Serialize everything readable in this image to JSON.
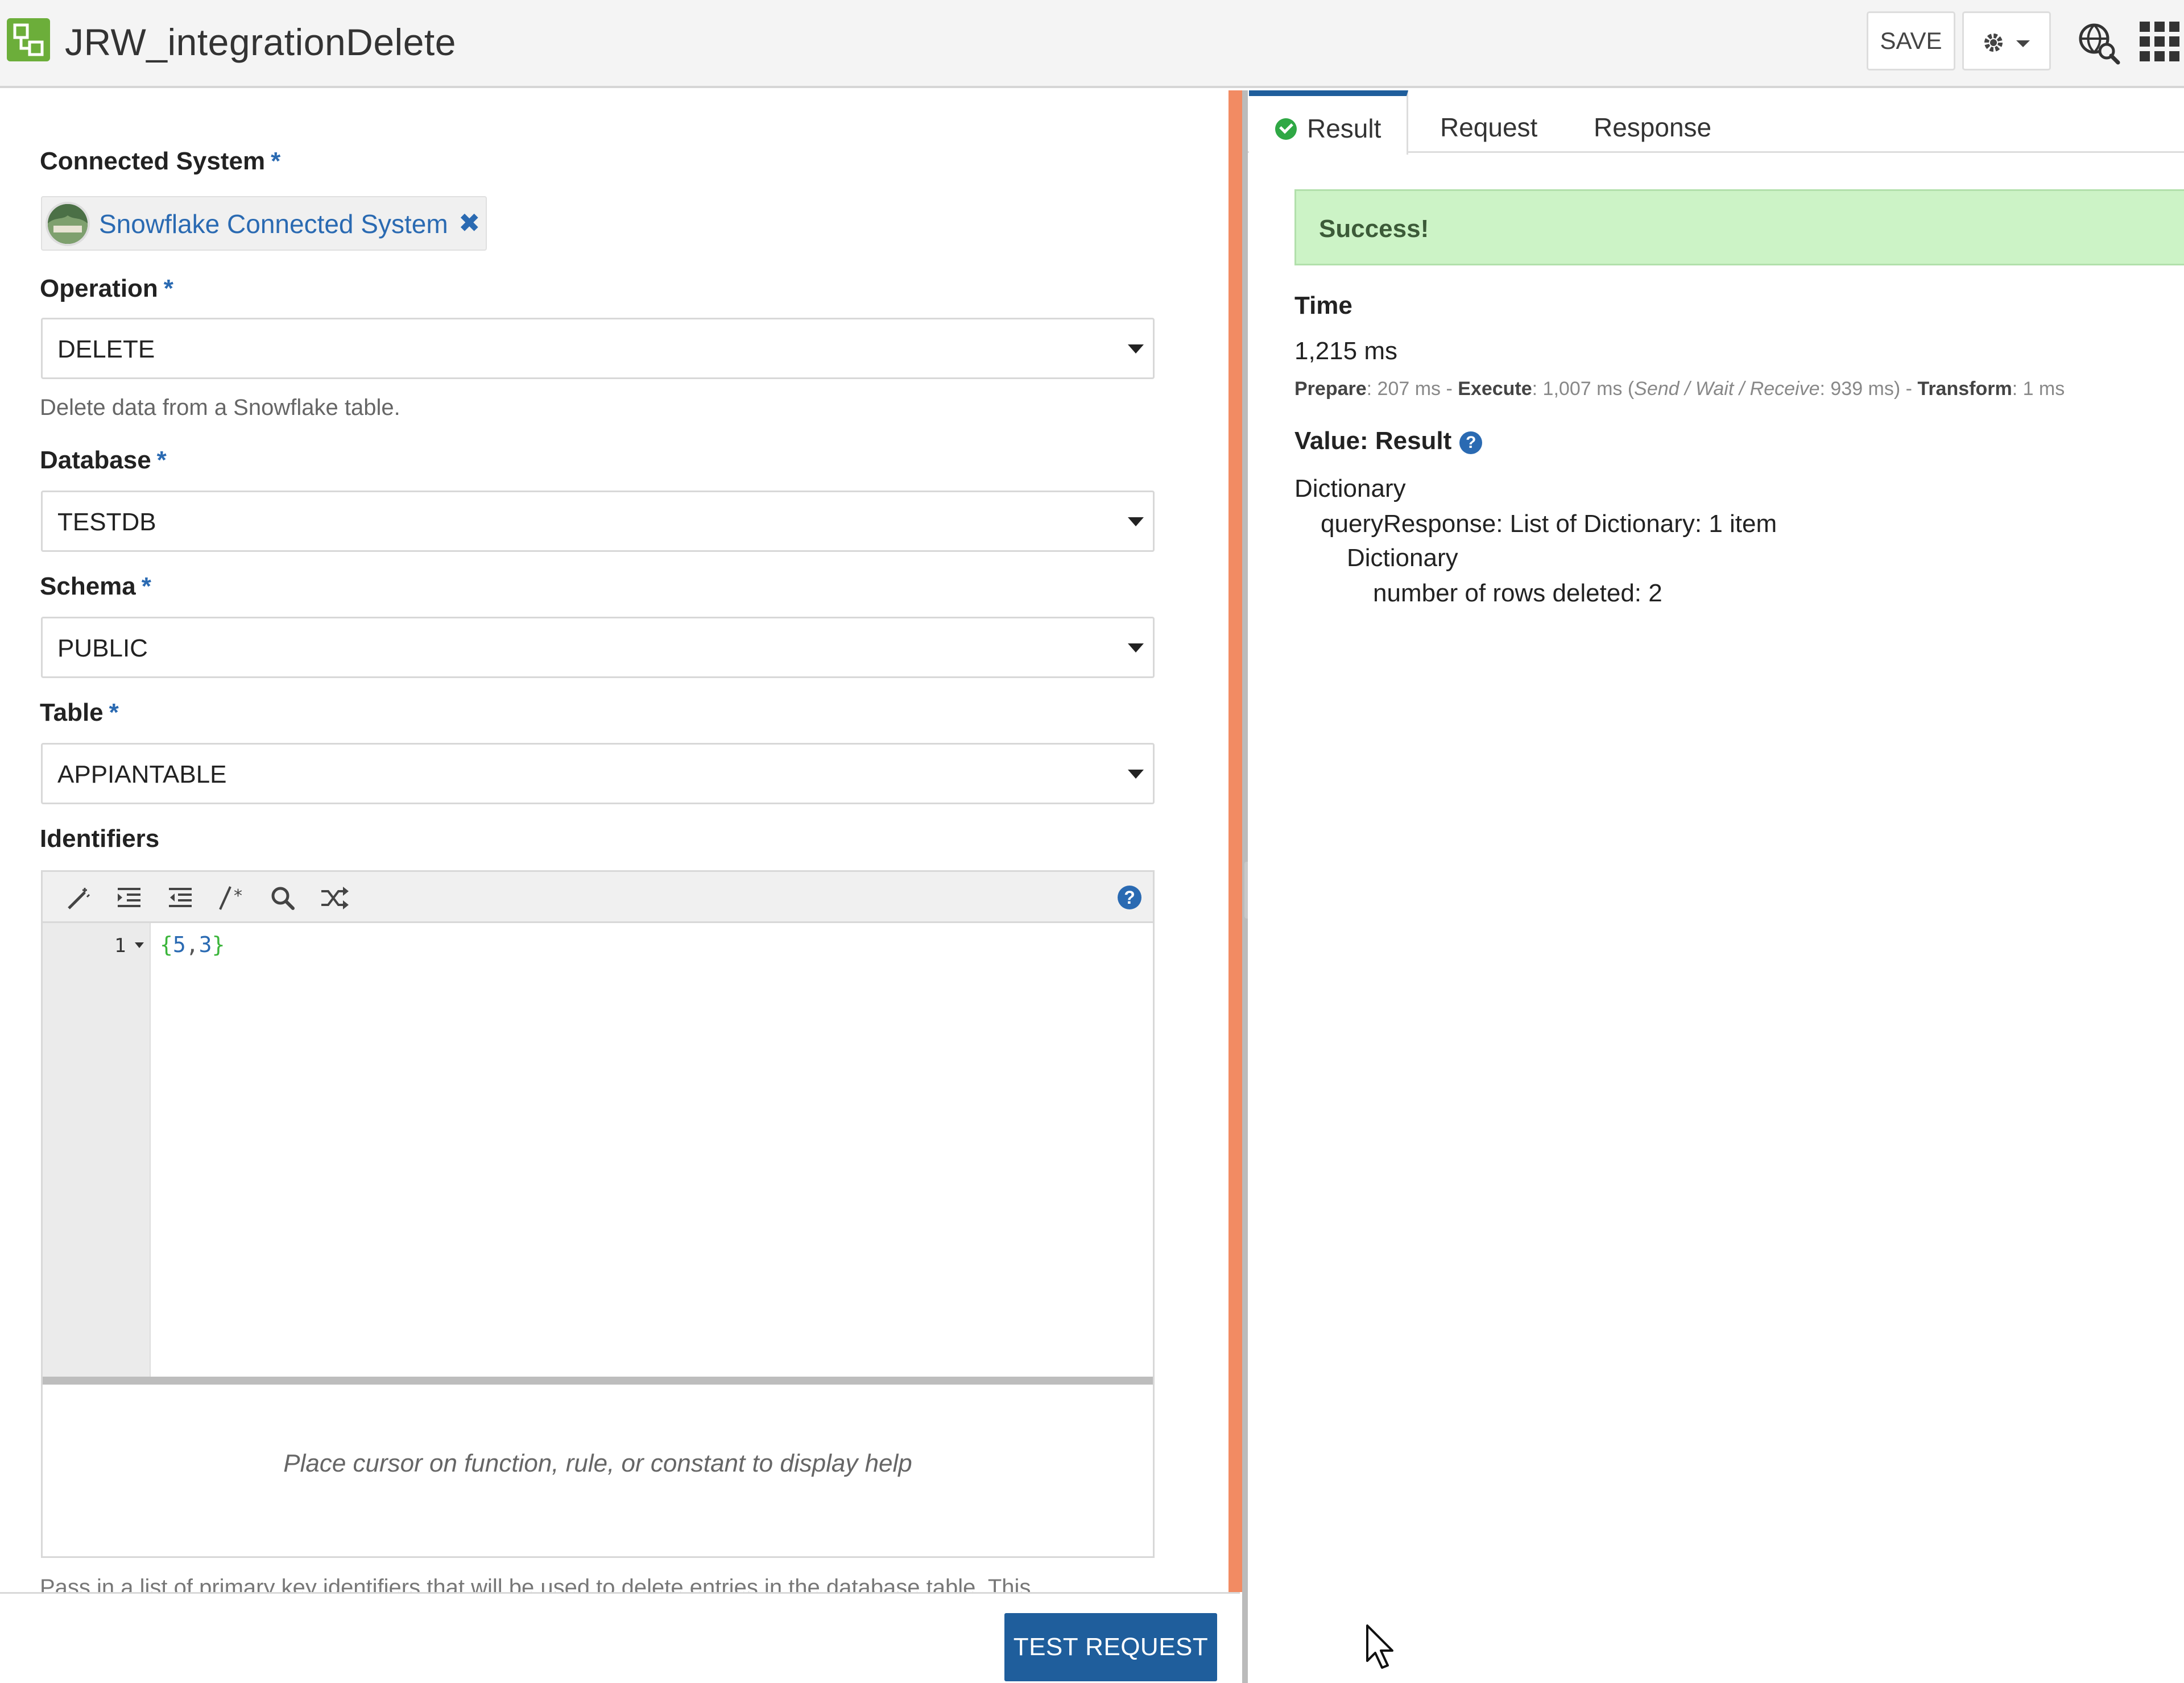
{
  "header": {
    "title": "JRW_integrationDelete",
    "save_label": "SAVE",
    "icons": {
      "logo": "integration-logo-icon",
      "settings": "gear-icon",
      "globe": "globe-search-icon",
      "apps": "apps-grid-icon"
    }
  },
  "form": {
    "connected_system": {
      "label": "Connected System",
      "required": "*",
      "value": "Snowflake Connected System",
      "remove": "✖"
    },
    "operation": {
      "label": "Operation",
      "required": "*",
      "value": "DELETE",
      "instruction": "Delete data from a Snowflake table."
    },
    "database": {
      "label": "Database",
      "required": "*",
      "value": "TESTDB"
    },
    "schema": {
      "label": "Schema",
      "required": "*",
      "value": "PUBLIC"
    },
    "table": {
      "label": "Table",
      "required": "*",
      "value": "APPIANTABLE"
    },
    "identifiers": {
      "label": "Identifiers",
      "help_glyph": "?",
      "line_number": "1",
      "code": {
        "open": "{",
        "n1": "5",
        "comma": ",",
        "n2": "3",
        "close": "}"
      },
      "help_text": "Place cursor on function, rule, or constant to display help",
      "description": "Pass in a list of primary key identifiers that will be used to delete entries in the database table. This"
    }
  },
  "footer": {
    "test_label": "TEST REQUEST"
  },
  "result_panel": {
    "tabs": [
      "Result",
      "Request",
      "Response"
    ],
    "status": "Success!",
    "time": {
      "heading": "Time",
      "total": "1,215 ms",
      "prepare_label": "Prepare",
      "prepare_value": ": 207 ms - ",
      "execute_label": "Execute",
      "execute_value": ": 1,007 ms (",
      "sub_label": "Send / Wait / Receive",
      "sub_value": ": 939 ms) - ",
      "transform_label": "Transform",
      "transform_value": ": 1 ms"
    },
    "value": {
      "heading": "Value: Result",
      "help_glyph": "?",
      "tree": [
        "Dictionary",
        "queryResponse: List of Dictionary: 1 item",
        "Dictionary",
        "number of rows deleted: 2"
      ]
    }
  },
  "colors": {
    "accent": "#1f5e9c",
    "link": "#2a6ab2",
    "divider": "#f28b63",
    "success_bg": "#ccf3c6",
    "logo": "#6cae3a"
  }
}
